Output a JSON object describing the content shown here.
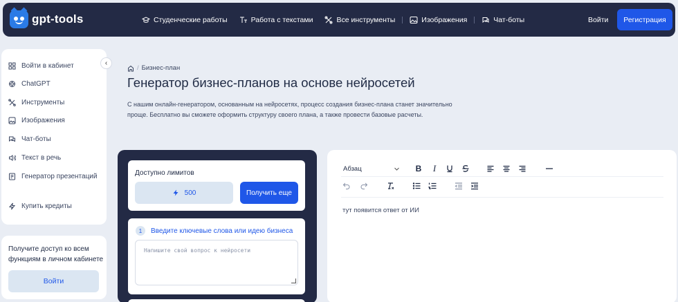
{
  "header": {
    "logo_text": "gpt-tools",
    "nav": [
      {
        "label": "Студенческие работы",
        "icon": "graduation-cap-icon"
      },
      {
        "label": "Работа с текстами",
        "icon": "text-icon"
      },
      {
        "label": "Все инструменты",
        "icon": "tools-icon"
      },
      {
        "label": "Изображения",
        "icon": "image-icon"
      },
      {
        "label": "Чат-боты",
        "icon": "chat-icon"
      }
    ],
    "login_label": "Войти",
    "register_label": "Регистрация"
  },
  "sidebar": {
    "items": [
      {
        "label": "Войти в кабинет",
        "icon": "grid-icon"
      },
      {
        "label": "ChatGPT",
        "icon": "openai-icon"
      },
      {
        "label": "Инструменты",
        "icon": "tools-icon"
      },
      {
        "label": "Изображения",
        "icon": "image-icon"
      },
      {
        "label": "Чат-боты",
        "icon": "chat-icon"
      },
      {
        "label": "Текст в речь",
        "icon": "speaker-icon"
      },
      {
        "label": "Генератор презентаций",
        "icon": "presentation-icon"
      },
      {
        "label": "Купить кредиты",
        "icon": "lightning-icon"
      }
    ],
    "promo_text": "Получите доступ ко всем функциям в личном кабинете",
    "promo_button": "Войти"
  },
  "main": {
    "breadcrumb": "Бизнес-план",
    "title": "Генератор бизнес-планов на основе нейросетей",
    "description": "С нашим онлайн-генератором, основанным на нейросетях, процесс создания бизнес-плана станет значительно проще. Бесплатно вы сможете оформить структуру своего плана, а также провести базовые расчеты."
  },
  "form": {
    "limits_label": "Доступно лимитов",
    "limits_count": "500",
    "more_button": "Получить еще",
    "step_number": "1",
    "step_label": "Введите ключевые слова или идею бизнеса",
    "step_placeholder": "Напишите свой вопрос к нейросети"
  },
  "editor": {
    "paragraph_select": "Абзац",
    "output_placeholder": "тут появится ответ от ИИ"
  },
  "colors": {
    "header_bg": "#232a45",
    "accent": "#1f57e8",
    "page_bg": "#e9edf4"
  }
}
